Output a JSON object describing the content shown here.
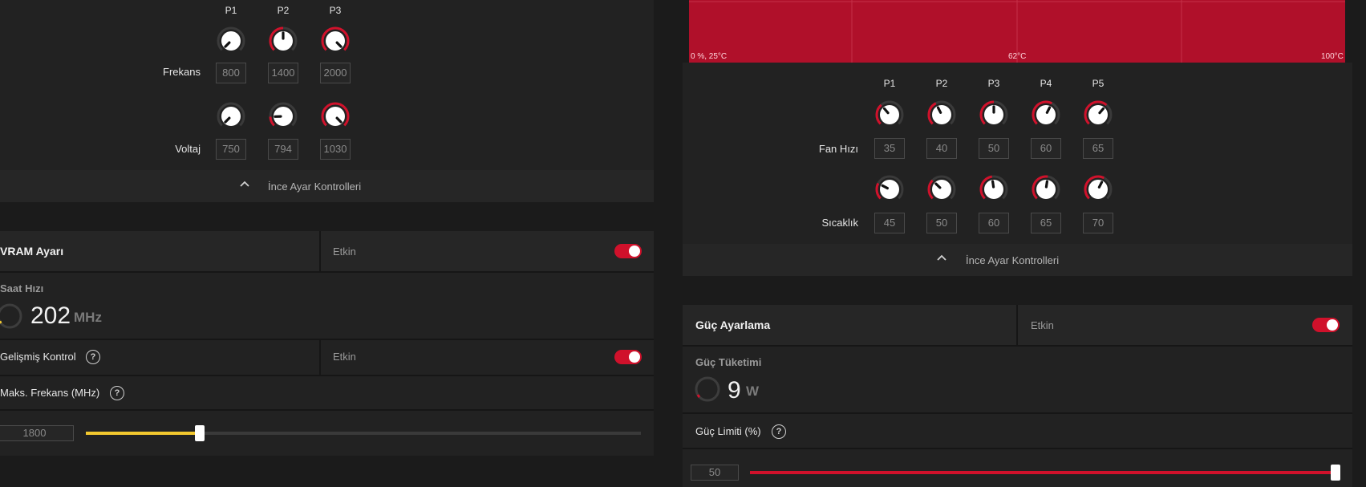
{
  "left_tuning": {
    "columns": [
      "P1",
      "P2",
      "P3"
    ],
    "freq_label": "Frekans",
    "freq_values": [
      "800",
      "1400",
      "2000"
    ],
    "freq_levels": [
      0.0,
      0.5,
      1.0
    ],
    "volt_label": "Voltaj",
    "volt_values": [
      "750",
      "794",
      "1030"
    ],
    "volt_levels": [
      0.0,
      0.16,
      1.0
    ],
    "fine_tune": "İnce Ayar Kontrolleri"
  },
  "vram": {
    "title": "VRAM Ayarı",
    "status": "Etkin",
    "enabled": true,
    "clock_title": "Saat Hızı",
    "clock_value": "202",
    "clock_unit": "MHz",
    "advanced_label": "Gelişmiş Kontrol",
    "advanced_status": "Etkin",
    "advanced_enabled": true,
    "max_freq_label": "Maks. Frekans (MHz)",
    "max_freq_value": "1800",
    "max_freq_fraction": 0.205
  },
  "fan_curve": {
    "axis_left": "0 %, 25°C",
    "axis_mid": "62°C",
    "axis_right": "100°C",
    "columns": [
      "P1",
      "P2",
      "P3",
      "P4",
      "P5"
    ],
    "speed_label": "Fan Hızı",
    "speed_values": [
      "35",
      "40",
      "50",
      "60",
      "65"
    ],
    "speed_levels": [
      0.35,
      0.4,
      0.5,
      0.6,
      0.65
    ],
    "temp_label": "Sıcaklık",
    "temp_values": [
      "45",
      "50",
      "60",
      "65",
      "70"
    ],
    "temp_levels": [
      0.27,
      0.33,
      0.47,
      0.53,
      0.6
    ],
    "fine_tune": "İnce Ayar Kontrolleri"
  },
  "power": {
    "title": "Güç Ayarlama",
    "status": "Etkin",
    "enabled": true,
    "consumption_title": "Güç Tüketimi",
    "consumption_value": "9",
    "consumption_unit": "W",
    "limit_label": "Güç Limiti (%)",
    "limit_value": "50",
    "limit_fraction": 1.0
  },
  "colors": {
    "accent_red": "#d0112b",
    "graph_red": "#b0102a",
    "slider_yellow": "#f2c82f",
    "panel": "#222222",
    "background": "#1b1b1b"
  }
}
